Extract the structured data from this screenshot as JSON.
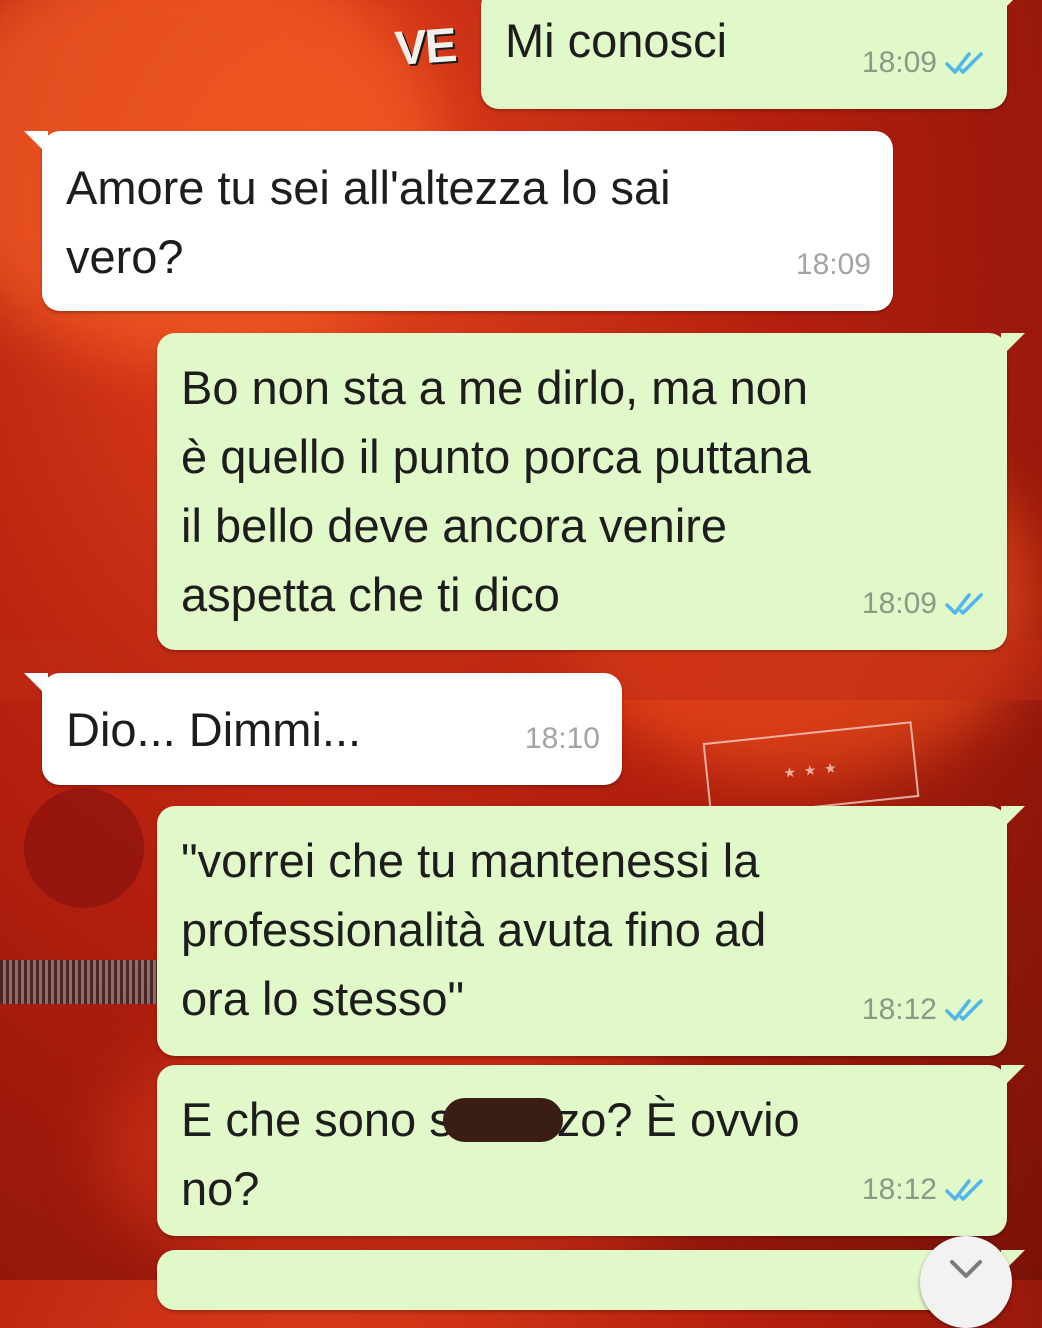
{
  "colors": {
    "outgoing_bubble": "#e1f8c9",
    "incoming_bubble": "#ffffff",
    "read_ticks": "#4fb6ec",
    "wallpaper": "#c0240f"
  },
  "wallpaper": {
    "poster_text": "VE"
  },
  "messages": [
    {
      "direction": "outgoing",
      "text": "Mi conosci",
      "time": "18:09",
      "status": "read"
    },
    {
      "direction": "incoming",
      "text": "Amore tu sei all'altezza lo sai\nvero?",
      "time": "18:09"
    },
    {
      "direction": "outgoing",
      "text": "Bo non sta a me dirlo, ma non\nè quello il punto porca puttana\nil bello deve ancora venire\naspetta che ti dico",
      "time": "18:09",
      "status": "read"
    },
    {
      "direction": "incoming",
      "text": "Dio... Dimmi...",
      "time": "18:10"
    },
    {
      "direction": "outgoing",
      "text": "\"vorrei che tu mantenessi la\nprofessionalità avuta fino ad\nora lo stesso\"",
      "time": "18:12",
      "status": "read"
    },
    {
      "direction": "outgoing",
      "text_before_redaction": "E che sono s",
      "text_after_redaction": "zo? È ovvio",
      "text_second_line": "no?",
      "time": "18:12",
      "status": "read"
    }
  ],
  "scroll_down_icon": "chevron-down-icon"
}
